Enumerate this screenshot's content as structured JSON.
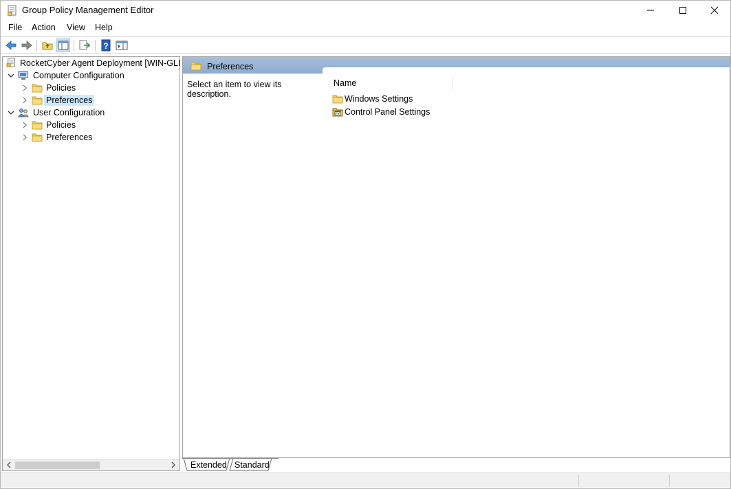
{
  "window": {
    "title": "Group Policy Management Editor",
    "title_icon": "gpo-editor-icon"
  },
  "controls": {
    "minimize_icon": "minimize-icon",
    "maximize_icon": "maximize-icon",
    "close_icon": "close-icon"
  },
  "menu": {
    "items": [
      "File",
      "Action",
      "View",
      "Help"
    ]
  },
  "toolbar": {
    "buttons": [
      "back-icon",
      "forward-icon",
      "up-folder-icon",
      "show-hide-console-tree-icon",
      "export-list-icon",
      "help-icon",
      "show-action-pane-icon"
    ]
  },
  "tree": {
    "root": "RocketCyber Agent Deployment [WIN-GLLP",
    "computer_config": {
      "label": "Computer Configuration",
      "children": [
        "Policies",
        "Preferences"
      ],
      "selected": "Preferences"
    },
    "user_config": {
      "label": "User Configuration",
      "children": [
        "Policies",
        "Preferences"
      ]
    }
  },
  "details": {
    "header": "Preferences",
    "description": "Select an item to view its description.",
    "column_name": "Name",
    "items": [
      {
        "label": "Windows Settings",
        "icon": "folder-icon"
      },
      {
        "label": "Control Panel Settings",
        "icon": "control-panel-folder-icon"
      }
    ]
  },
  "tabs": [
    "Extended",
    "Standard"
  ],
  "tabs_active": "Extended",
  "colors": {
    "header_band": "#a7bfd9",
    "selection": "#cce8ff",
    "folder": "#f4d26a"
  }
}
